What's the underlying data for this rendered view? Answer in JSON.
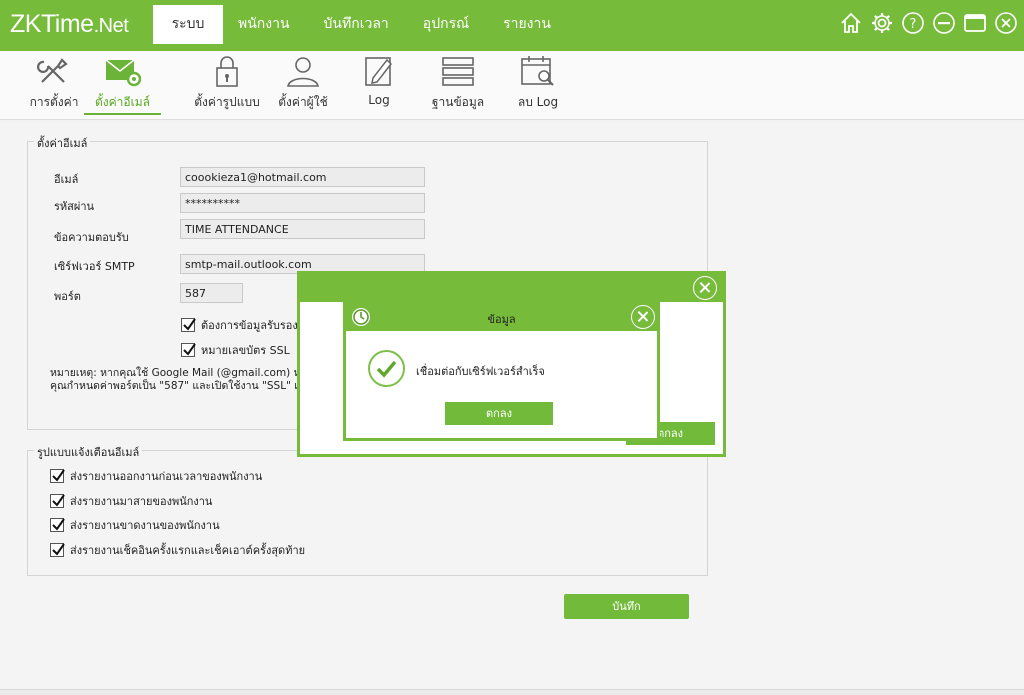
{
  "app": {
    "logo_main": "ZKTime",
    "logo_suffix": ".Net"
  },
  "nav": {
    "items": [
      {
        "label": "ระบบ",
        "active": true
      },
      {
        "label": "พนักงาน"
      },
      {
        "label": "บันทึกเวลา"
      },
      {
        "label": "อุปกรณ์"
      },
      {
        "label": "รายงาน"
      }
    ]
  },
  "window_icons": [
    "home-icon",
    "gear-icon",
    "help-icon",
    "minimize-icon",
    "maximize-icon",
    "close-icon"
  ],
  "toolbar": {
    "items": [
      {
        "label": "การตั้งค่า",
        "icon": "tools-icon"
      },
      {
        "label": "ตั้งค่าอีเมล์",
        "icon": "email-settings-icon",
        "active": true
      },
      {
        "label": "ตั้งค่ารูปแบบ",
        "icon": "lock-icon"
      },
      {
        "label": "ตั้งค่าผู้ใช้",
        "icon": "user-icon"
      },
      {
        "label": "Log",
        "icon": "log-icon"
      },
      {
        "label": "ฐานข้อมูล",
        "icon": "database-icon"
      },
      {
        "label": "ลบ Log",
        "icon": "delete-log-icon"
      }
    ]
  },
  "email_settings": {
    "legend": "ตั้งค่าอีเมล์",
    "email_label": "อีเมล์",
    "email_value": "coookieza1@hotmail.com",
    "password_label": "รหัสผ่าน",
    "password_value": "**********",
    "reply_label": "ข้อความตอบรับ",
    "reply_value": "TIME ATTENDANCE",
    "smtp_label": "เซิร์ฟเวอร์ SMTP",
    "smtp_value": "smtp-mail.outlook.com",
    "port_label": "พอร์ต",
    "port_value": "587",
    "auth_label": "ต้องการข้อมูลรับรอง",
    "ssl_label": "หมายเลขบัตร SSL",
    "note_line1": "หมายเหตุ: หากคุณใช้ Google Mail (@gmail.com) หรือ",
    "note_line2": "คุณกำหนดค่าพอร์ตเป็น \"587\" และเปิดใช้งาน \"SSL\" เท่"
  },
  "notification": {
    "legend": "รูปแบบแจ้งเตือนอีเมล์",
    "items": [
      "ส่งรายงานออกงานก่อนเวลาของพนักงาน",
      "ส่งรายงานมาสายของพนักงาน",
      "ส่งรายงานขาดงานของพนักงาน",
      "ส่งรายงานเช็คอินครั้งแรกและเช็คเอาต์ครั้งสุดท้าย"
    ]
  },
  "save_label": "บันทึก",
  "outer_dialog": {
    "ok_label": "ตกลง"
  },
  "inner_dialog": {
    "title": "ข้อมูล",
    "message": "เชื่อมต่อกับเซิร์ฟเวอร์สำเร็จ",
    "ok_label": "ตกลง"
  },
  "colors": {
    "brand": "#76bb3a",
    "accent_text": "#5aa823"
  }
}
